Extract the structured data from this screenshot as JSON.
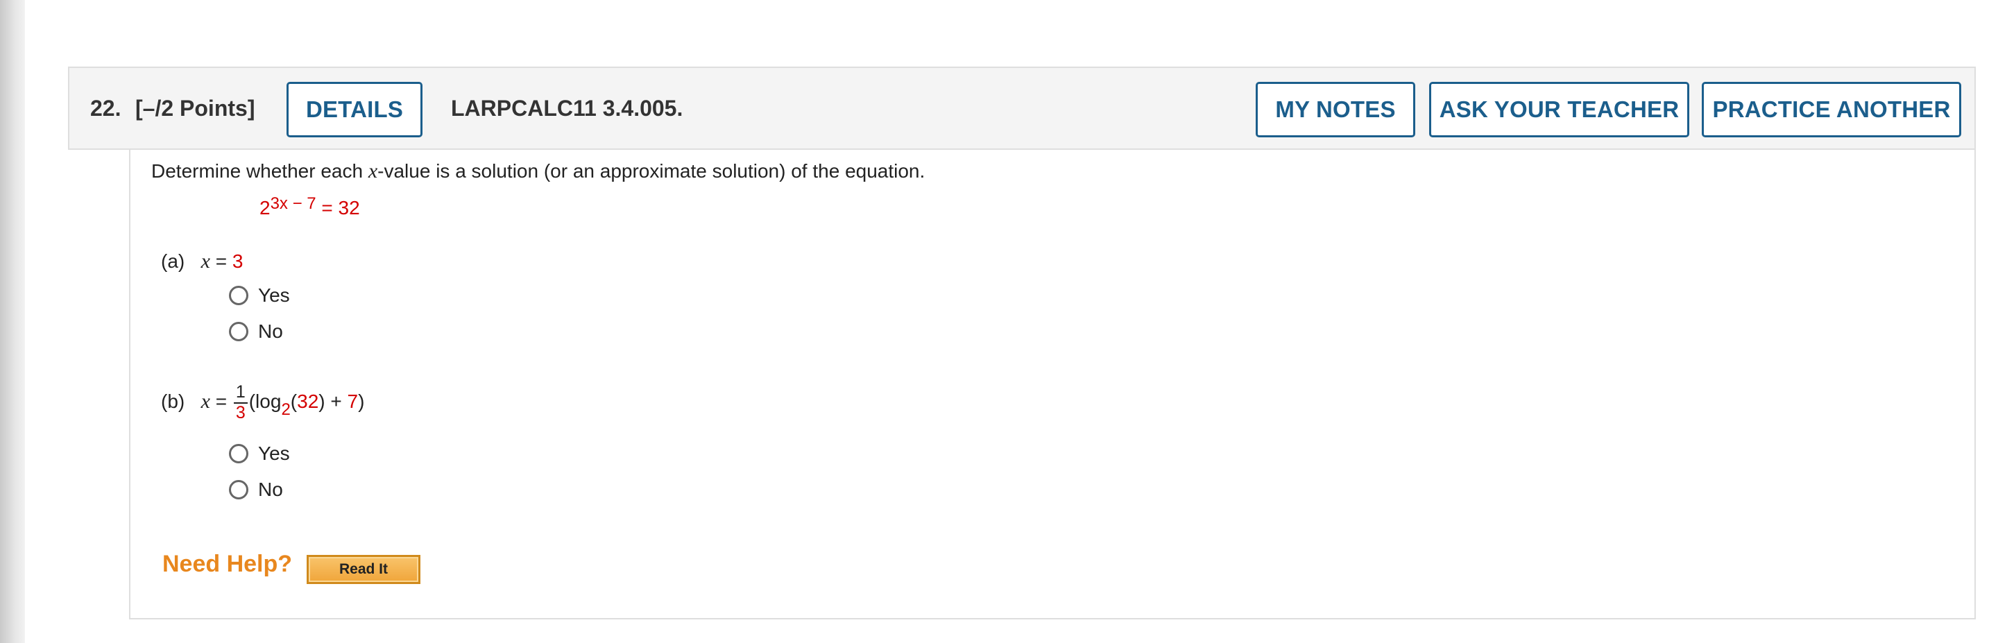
{
  "question": {
    "number": "22.",
    "points": "[–/2 Points]",
    "details_label": "DETAILS",
    "code": "LARPCALC11 3.4.005.",
    "my_notes_label": "MY NOTES",
    "ask_teacher_label": "ASK YOUR TEACHER",
    "practice_another_label": "PRACTICE ANOTHER"
  },
  "body": {
    "prompt_before": "Determine whether each ",
    "prompt_var": "x",
    "prompt_after": "-value is a solution (or an approximate solution) of the equation.",
    "equation": {
      "base": "2",
      "exponent": "3x − 7",
      "equals": "= 32"
    },
    "part_a": {
      "label": "(a)",
      "var": "x",
      "eq": "=",
      "value": "3",
      "options": [
        "Yes",
        "No"
      ]
    },
    "part_b": {
      "label": "(b)",
      "var": "x",
      "eq": "=",
      "frac_num": "1",
      "frac_den": "3",
      "expr_open": "(log",
      "log_base": "2",
      "arg_open": "(",
      "arg": "32",
      "arg_close": ")",
      "plus": " + ",
      "addend": "7",
      "expr_close": ")",
      "options": [
        "Yes",
        "No"
      ]
    },
    "need_help_label": "Need Help?",
    "read_it_label": "Read It"
  },
  "colors": {
    "accent": "#1b5e8c",
    "answer_red": "#d40000",
    "need_help_orange": "#e8871e"
  }
}
